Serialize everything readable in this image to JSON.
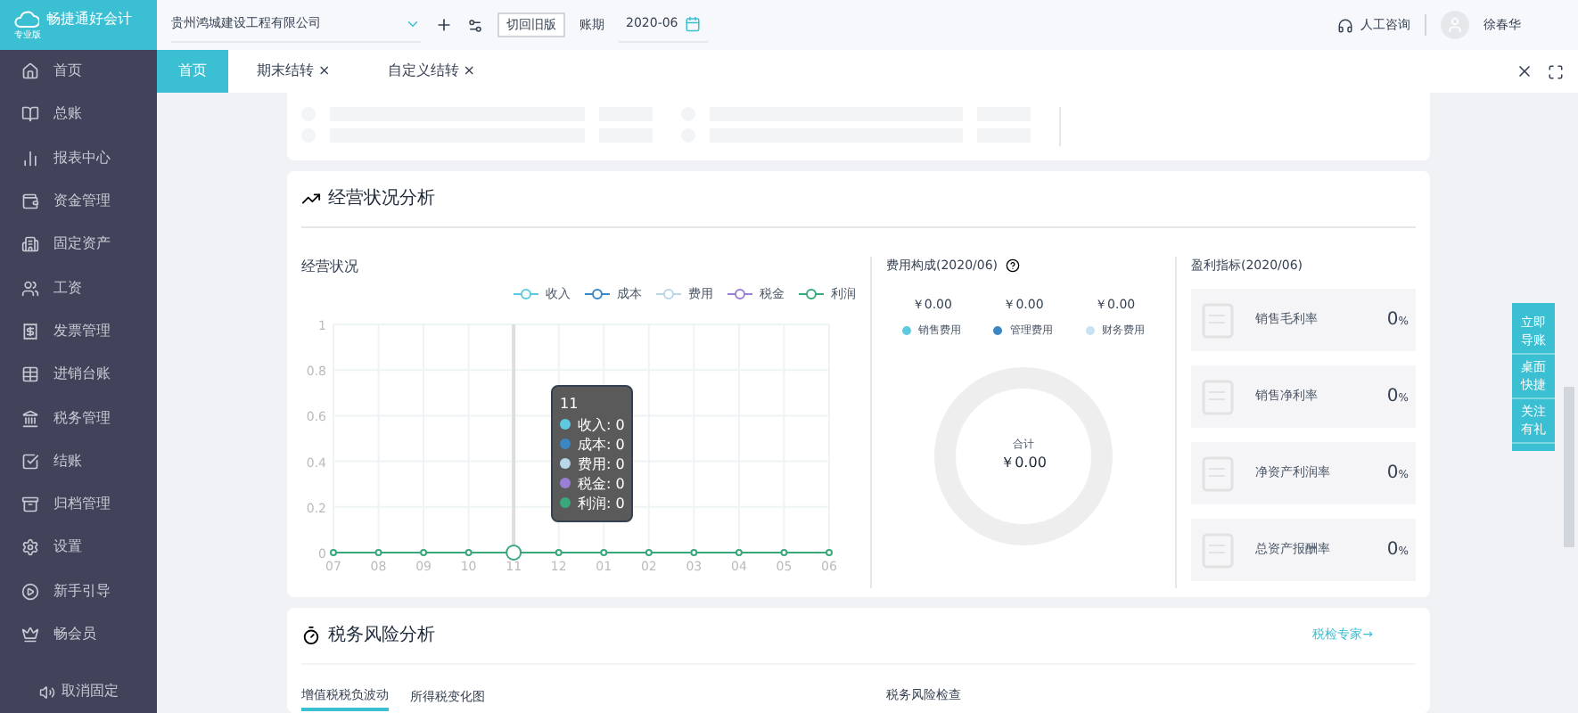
{
  "logo": {
    "title": "畅捷通好会计",
    "edition": "专业版"
  },
  "topbar": {
    "company": "贵州鸿城建设工程有限公司",
    "switch_button": "切回旧版",
    "period_label": "账期",
    "period": "2020-06",
    "support": "人工咨询",
    "user": "徐春华"
  },
  "sidebar": {
    "items": [
      {
        "label": "首页"
      },
      {
        "label": "总账"
      },
      {
        "label": "报表中心"
      },
      {
        "label": "资金管理"
      },
      {
        "label": "固定资产"
      },
      {
        "label": "工资"
      },
      {
        "label": "发票管理"
      },
      {
        "label": "进销台账"
      },
      {
        "label": "税务管理"
      },
      {
        "label": "结账"
      },
      {
        "label": "归档管理"
      },
      {
        "label": "设置"
      },
      {
        "label": "新手引导"
      },
      {
        "label": "畅会员"
      }
    ],
    "unpin": "取消固定"
  },
  "tabs": [
    {
      "label": "首页",
      "selected": true,
      "closable": false
    },
    {
      "label": "期末结转",
      "selected": false,
      "closable": true
    },
    {
      "label": "自定义结转",
      "selected": false,
      "closable": true
    }
  ],
  "tab_close": "×",
  "business": {
    "title": "经营状况分析",
    "chart_data": {
      "type": "line",
      "title": "经营状况",
      "grid": true,
      "legend": "top-right",
      "ref_lines": [
        {
          "axis": "x",
          "value": "11",
          "color": "#dddddd"
        }
      ],
      "categories": [
        "07",
        "08",
        "09",
        "10",
        "11",
        "12",
        "01",
        "02",
        "03",
        "04",
        "05",
        "06"
      ],
      "ylim": [
        0,
        1
      ],
      "yticks": [
        0,
        0.2,
        0.4,
        0.6,
        0.8,
        1
      ],
      "series": [
        {
          "name": "收入",
          "color": "#5fc9e0",
          "marker": "circle",
          "values": [
            null,
            null,
            null,
            null,
            null,
            null,
            null,
            null,
            null,
            null,
            null,
            null
          ]
        },
        {
          "name": "成本",
          "color": "#3a87c4",
          "marker": "circle",
          "values": [
            null,
            null,
            null,
            null,
            null,
            null,
            null,
            null,
            null,
            null,
            null,
            null
          ]
        },
        {
          "name": "费用",
          "color": "#b8d8ea",
          "marker": "circle",
          "values": [
            null,
            null,
            null,
            null,
            null,
            null,
            null,
            null,
            null,
            null,
            null,
            null
          ]
        },
        {
          "name": "税金",
          "color": "#9b7fd6",
          "marker": "circle",
          "values": [
            null,
            null,
            null,
            null,
            null,
            null,
            null,
            null,
            null,
            null,
            null,
            null
          ]
        },
        {
          "name": "利润",
          "color": "#3aa87a",
          "marker": "circle",
          "values": [
            0,
            0,
            0,
            0,
            0,
            0,
            0,
            0,
            0,
            0,
            0,
            0
          ]
        }
      ]
    },
    "tooltip": {
      "title": "11",
      "rows": [
        "收入: 0",
        "成本: 0",
        "费用: 0",
        "税金: 0",
        "利润: 0"
      ]
    },
    "expenses": {
      "title": "费用构成(2020/06)",
      "items": [
        {
          "amount": "￥0.00",
          "label": "销售费用",
          "color": "#5fc9e0"
        },
        {
          "amount": "￥0.00",
          "label": "管理费用",
          "color": "#3a87c4"
        },
        {
          "amount": "￥0.00",
          "label": "财务费用",
          "color": "#c8e2f0"
        }
      ],
      "total_label": "合计",
      "total": "￥0.00"
    },
    "profit": {
      "title": "盈利指标(2020/06)",
      "items": [
        {
          "label": "销售毛利率",
          "value": "0",
          "unit": "%"
        },
        {
          "label": "销售净利率",
          "value": "0",
          "unit": "%"
        },
        {
          "label": "净资产利润率",
          "value": "0",
          "unit": "%"
        },
        {
          "label": "总资产报酬率",
          "value": "0",
          "unit": "%"
        }
      ]
    }
  },
  "float_buttons": [
    "立即导账",
    "桌面快捷",
    "关注有礼"
  ],
  "tax": {
    "title": "税务风险分析",
    "link": "税检专家→",
    "tabs": [
      {
        "label": "增值税税负波动",
        "selected": true
      },
      {
        "label": "所得税变化图",
        "selected": false
      }
    ],
    "check_title": "税务风险检查"
  }
}
